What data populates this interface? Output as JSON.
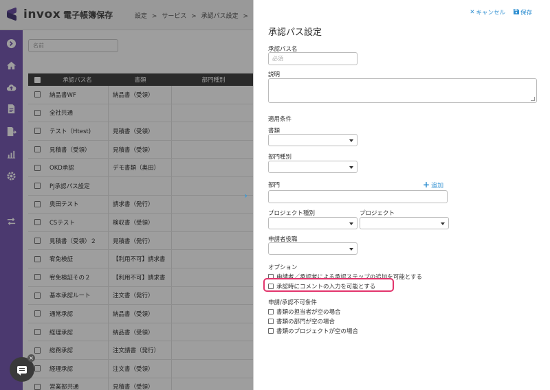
{
  "app": {
    "logo_text": "invox",
    "logo_sub": "電子帳簿保存",
    "breadcrumbs": [
      "設定",
      ">",
      "サービス",
      ">",
      "承認パス設定",
      ">"
    ]
  },
  "sidebar": {
    "items": [
      {
        "icon": "arrow-right-circle-icon"
      },
      {
        "icon": "home-icon"
      },
      {
        "icon": "cloud-upload-icon"
      },
      {
        "icon": "document-icon"
      },
      {
        "icon": "document-export-icon"
      },
      {
        "icon": "chart-icon"
      },
      {
        "icon": "gear-icon"
      },
      {
        "icon": "switch-icon"
      }
    ]
  },
  "list": {
    "search_placeholder": "名前",
    "headers": [
      "承認パス名",
      "書類",
      "部門種別"
    ],
    "rows": [
      {
        "name": "納品書WF",
        "doc": "納品書（受領）",
        "dept": ""
      },
      {
        "name": "全社共通",
        "doc": "",
        "dept": ""
      },
      {
        "name": "テスト（Htest)",
        "doc": "見積書（受領）",
        "dept": ""
      },
      {
        "name": "見積書（受領）",
        "doc": "見積書（受領）",
        "dept": ""
      },
      {
        "name": "OKD承認",
        "doc": "デモ書類（奥田）",
        "dept": ""
      },
      {
        "name": "PJ承認パス設定",
        "doc": "",
        "dept": ""
      },
      {
        "name": "奥田テスト",
        "doc": "請求書（発行）",
        "dept": ""
      },
      {
        "name": "CSテスト",
        "doc": "検収書（受領）",
        "dept": ""
      },
      {
        "name": "見積書（受領）２",
        "doc": "見積書（発行）",
        "dept": ""
      },
      {
        "name": "宥免検証",
        "doc": "【利用不可】請求書",
        "dept": ""
      },
      {
        "name": "宥免検証その２",
        "doc": "【利用不可】請求書",
        "dept": ""
      },
      {
        "name": "基本承認ルート",
        "doc": "注文書（発行）",
        "dept": ""
      },
      {
        "name": "通常承認",
        "doc": "納品書（受領）",
        "dept": ""
      },
      {
        "name": "経理承認",
        "doc": "納品書（受領）",
        "dept": ""
      },
      {
        "name": "総務承認",
        "doc": "注文請書（発行）",
        "dept": ""
      },
      {
        "name": "経理承認",
        "doc": "注文書（受領）",
        "dept": ""
      },
      {
        "name": "営業部共通",
        "doc": "見積書（受領）",
        "dept": ""
      }
    ]
  },
  "panel": {
    "cancel_label": "キャンセル",
    "save_label": "保存",
    "title": "承認パス設定",
    "name_label": "承認パス名",
    "name_placeholder": "必須",
    "description_label": "説明",
    "conditions_label": "適用条件",
    "doc_label": "書類",
    "dept_type_label": "部門種別",
    "dept_label": "部門",
    "add_label": "追加",
    "project_type_label": "プロジェクト種別",
    "project_label": "プロジェクト",
    "applicant_role_label": "申請者役職",
    "options_label": "オプション",
    "options": [
      "申請者／承認者による承認ステップの追加を可能とする",
      "承認時にコメントの入力を可能とする"
    ],
    "restrictions_label": "申請/承認不可条件",
    "restrictions": [
      "書類の担当者が空の場合",
      "書類の部門が空の場合",
      "書類のプロジェクトが空の場合"
    ]
  },
  "colors": {
    "sidebar": "#7a5cb3",
    "link": "#2f8fd1",
    "highlight": "#e2336b",
    "table_header": "#444444"
  }
}
